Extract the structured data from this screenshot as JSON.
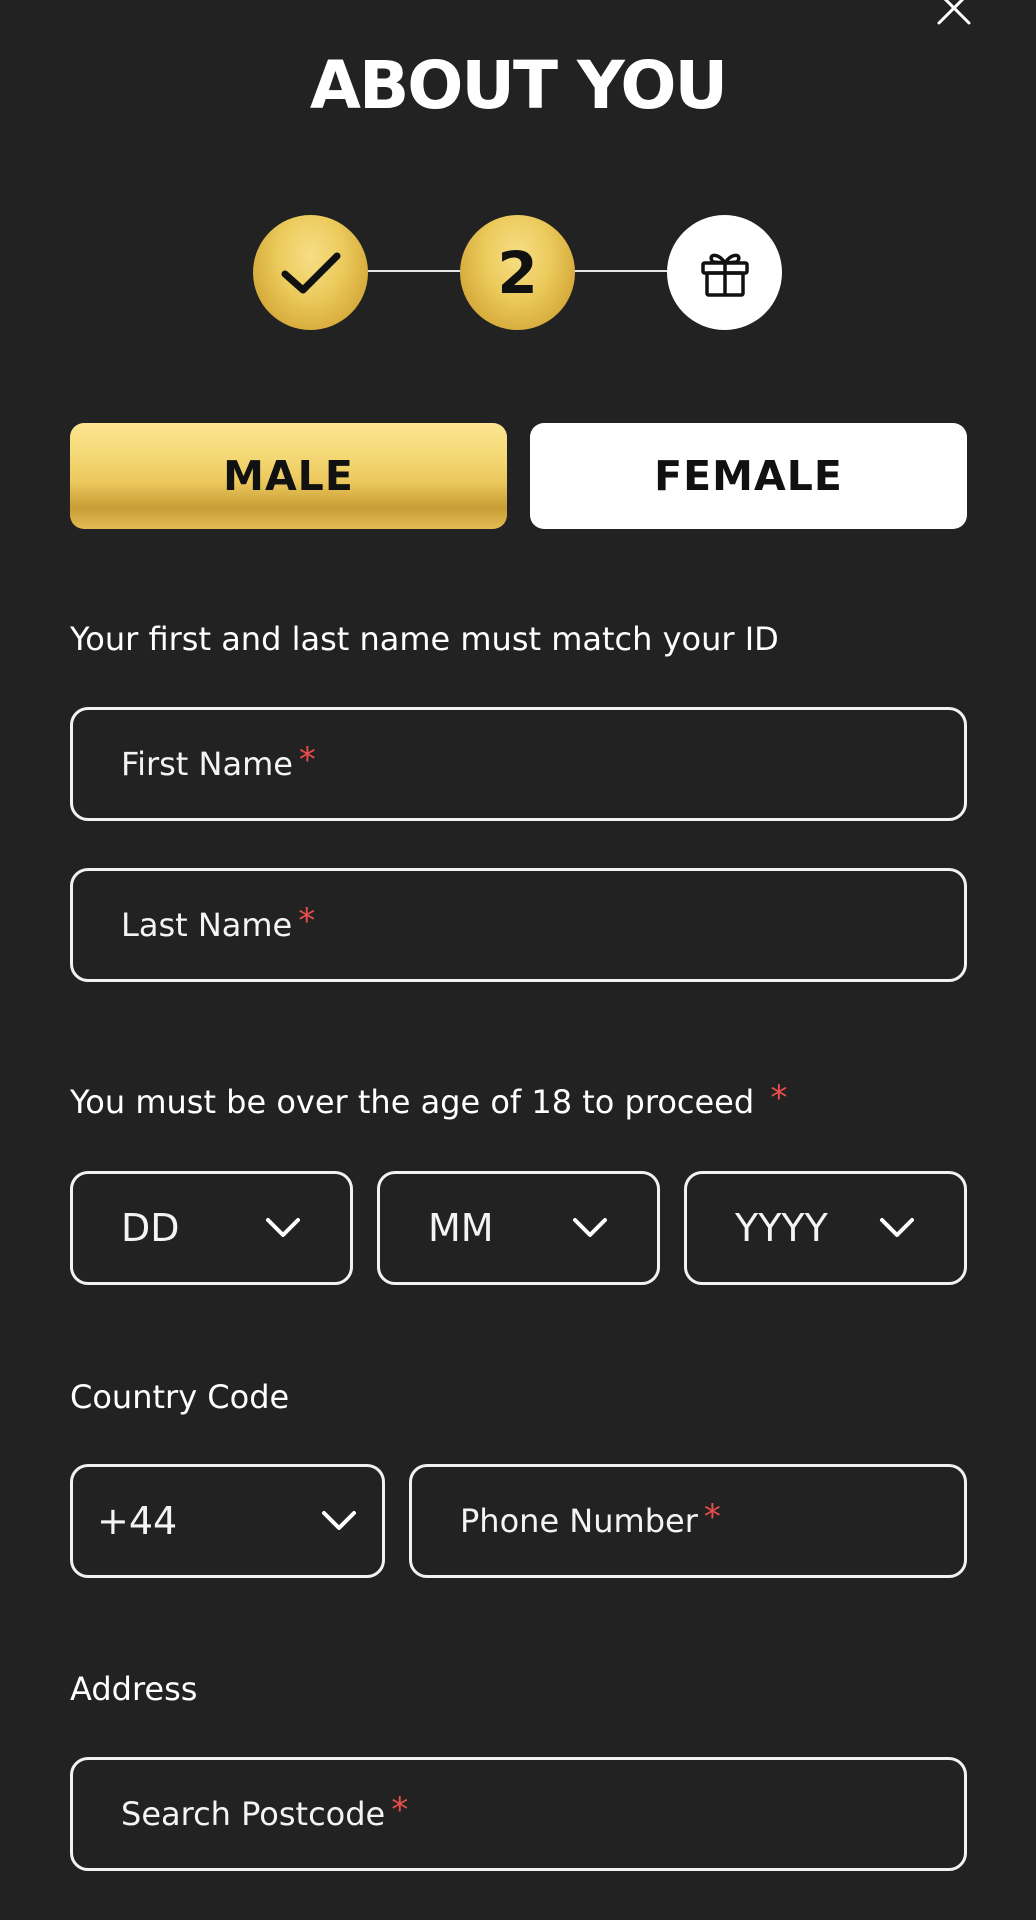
{
  "header": {
    "title": "ABOUT YOU",
    "close_icon": "close-icon"
  },
  "stepper": {
    "steps": [
      {
        "state": "completed",
        "icon": "checkmark-icon"
      },
      {
        "state": "current",
        "label": "2"
      },
      {
        "state": "upcoming",
        "icon": "gift-icon"
      }
    ],
    "active_color": "#e8c458"
  },
  "gender": {
    "options": [
      {
        "label": "MALE",
        "selected": true
      },
      {
        "label": "FEMALE",
        "selected": false
      }
    ]
  },
  "name_section": {
    "hint": "Your first and last name must match your ID",
    "first_name_placeholder": "First Name",
    "last_name_placeholder": "Last Name",
    "required_mark": "*"
  },
  "dob_section": {
    "hint": "You must be over the age of 18 to proceed",
    "required_mark": "*",
    "day_value": "DD",
    "month_value": "MM",
    "year_value": "YYYY"
  },
  "phone_section": {
    "label": "Country Code",
    "country_code_value": "+44",
    "phone_placeholder": "Phone Number",
    "required_mark": "*"
  },
  "address_section": {
    "label": "Address",
    "postcode_placeholder": "Search Postcode",
    "required_mark": "*"
  },
  "colors": {
    "background": "#222222",
    "gold": "#e8c458",
    "required": "#e94c4c"
  }
}
